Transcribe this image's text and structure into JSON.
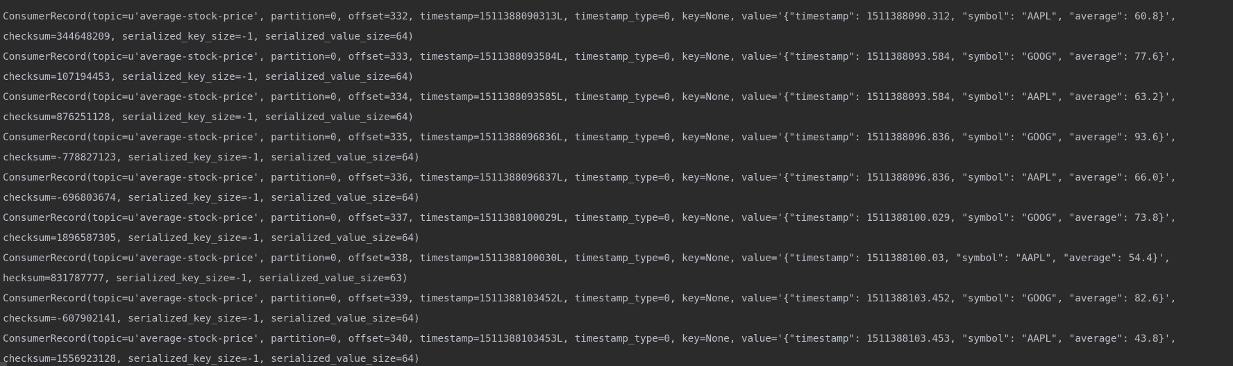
{
  "console": {
    "lines": [
      "ConsumerRecord(topic=u'average-stock-price', partition=0, offset=332, timestamp=1511388090313L, timestamp_type=0, key=None, value='{\"timestamp\": 1511388090.312, \"symbol\": \"AAPL\", \"average\": 60.8}',",
      "checksum=344648209, serialized_key_size=-1, serialized_value_size=64)",
      "ConsumerRecord(topic=u'average-stock-price', partition=0, offset=333, timestamp=1511388093584L, timestamp_type=0, key=None, value='{\"timestamp\": 1511388093.584, \"symbol\": \"GOOG\", \"average\": 77.6}',",
      "checksum=107194453, serialized_key_size=-1, serialized_value_size=64)",
      "ConsumerRecord(topic=u'average-stock-price', partition=0, offset=334, timestamp=1511388093585L, timestamp_type=0, key=None, value='{\"timestamp\": 1511388093.584, \"symbol\": \"AAPL\", \"average\": 63.2}',",
      "checksum=876251128, serialized_key_size=-1, serialized_value_size=64)",
      "ConsumerRecord(topic=u'average-stock-price', partition=0, offset=335, timestamp=1511388096836L, timestamp_type=0, key=None, value='{\"timestamp\": 1511388096.836, \"symbol\": \"GOOG\", \"average\": 93.6}',",
      "checksum=-778827123, serialized_key_size=-1, serialized_value_size=64)",
      "ConsumerRecord(topic=u'average-stock-price', partition=0, offset=336, timestamp=1511388096837L, timestamp_type=0, key=None, value='{\"timestamp\": 1511388096.836, \"symbol\": \"AAPL\", \"average\": 66.0}',",
      "checksum=-696803674, serialized_key_size=-1, serialized_value_size=64)",
      "ConsumerRecord(topic=u'average-stock-price', partition=0, offset=337, timestamp=1511388100029L, timestamp_type=0, key=None, value='{\"timestamp\": 1511388100.029, \"symbol\": \"GOOG\", \"average\": 73.8}',",
      "checksum=1896587305, serialized_key_size=-1, serialized_value_size=64)",
      "ConsumerRecord(topic=u'average-stock-price', partition=0, offset=338, timestamp=1511388100030L, timestamp_type=0, key=None, value='{\"timestamp\": 1511388100.03, \"symbol\": \"AAPL\", \"average\": 54.4}',",
      "hecksum=831787777, serialized_key_size=-1, serialized_value_size=63)",
      "ConsumerRecord(topic=u'average-stock-price', partition=0, offset=339, timestamp=1511388103452L, timestamp_type=0, key=None, value='{\"timestamp\": 1511388103.452, \"symbol\": \"GOOG\", \"average\": 82.6}',",
      "checksum=-607902141, serialized_key_size=-1, serialized_value_size=64)",
      "ConsumerRecord(topic=u'average-stock-price', partition=0, offset=340, timestamp=1511388103453L, timestamp_type=0, key=None, value='{\"timestamp\": 1511388103.453, \"symbol\": \"AAPL\", \"average\": 43.8}',",
      "checksum=1556923128, serialized_key_size=-1, serialized_value_size=64)"
    ]
  },
  "colors": {
    "background": "#2b2b2b",
    "text": "#b9bec7"
  }
}
